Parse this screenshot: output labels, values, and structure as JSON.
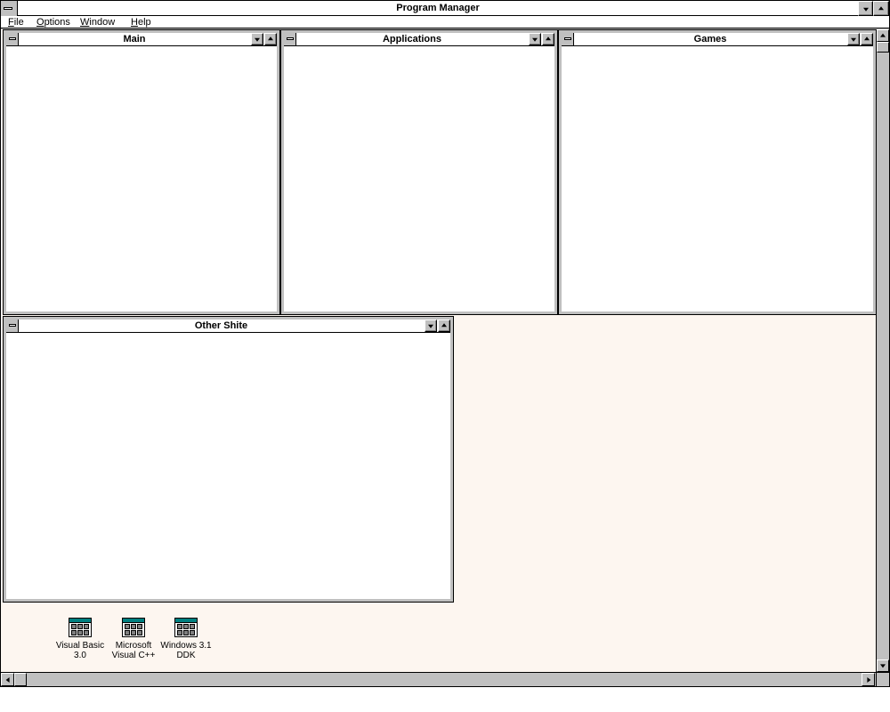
{
  "window": {
    "title": "Program Manager"
  },
  "menu": [
    {
      "label": "File",
      "accel": "F",
      "rest": "ile"
    },
    {
      "label": "Options",
      "accel": "O",
      "rest": "ptions"
    },
    {
      "label": "Window",
      "accel": "W",
      "rest": "indow"
    },
    {
      "label": "Help",
      "accel": "H",
      "rest": "elp"
    }
  ],
  "groups": [
    {
      "title": "Main"
    },
    {
      "title": "Applications"
    },
    {
      "title": "Games"
    },
    {
      "title": "Other Shite"
    }
  ],
  "minimized_groups": [
    {
      "line1": "Visual Basic",
      "line2": "3.0"
    },
    {
      "line1": "Microsoft",
      "line2": "Visual C++"
    },
    {
      "line1": "Windows 3.1",
      "line2": "DDK"
    }
  ],
  "colors": {
    "workspace": "#fdf6f0",
    "chrome": "#c0c0c0",
    "icon_accent": "#008080"
  }
}
